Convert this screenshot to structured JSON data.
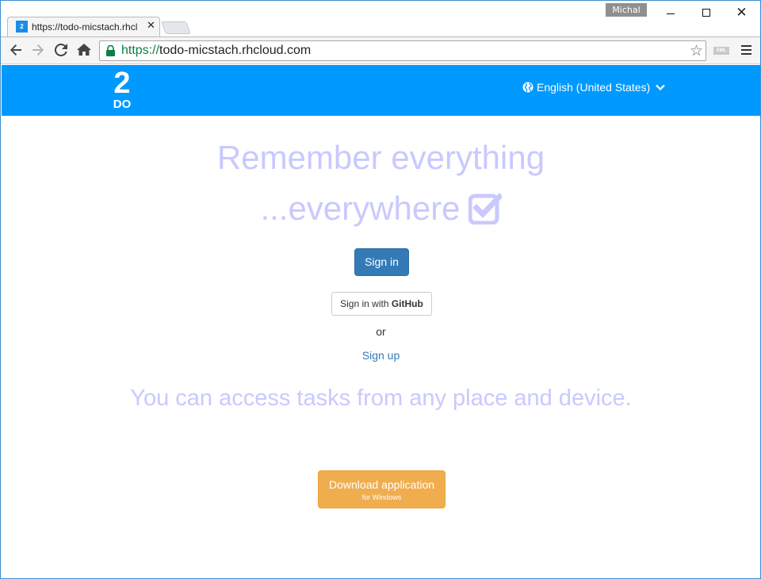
{
  "browser": {
    "user_badge": "Michal",
    "tab_title": "https://todo-micstach.rhcl",
    "tab_favicon_text": "2",
    "url_scheme": "https://",
    "url_host": "todo-micstach.rhcloud.com",
    "xml_badge": "XML"
  },
  "header": {
    "logo_top": "2",
    "logo_bottom": "DO",
    "language": "English (United States)"
  },
  "main": {
    "headline_line1": "Remember everything",
    "headline_line2": "...everywhere",
    "signin_label": "Sign in",
    "github_prefix": "Sign in with ",
    "github_brand": "GitHub",
    "or_text": "or",
    "signup_label": "Sign up",
    "tagline": "You can access tasks from any place and device.",
    "download_label": "Download application",
    "download_sub": "for Windows"
  },
  "colors": {
    "header_bg": "#0099ff",
    "headline": "#c9c9ff",
    "primary_button": "#337ab7",
    "download_button": "#f0ad4e"
  },
  "icons": [
    "back-arrow-icon",
    "forward-arrow-icon",
    "reload-icon",
    "home-icon",
    "lock-icon",
    "star-icon",
    "menu-icon",
    "globe-icon",
    "chevron-down-icon",
    "checkbox-icon"
  ]
}
